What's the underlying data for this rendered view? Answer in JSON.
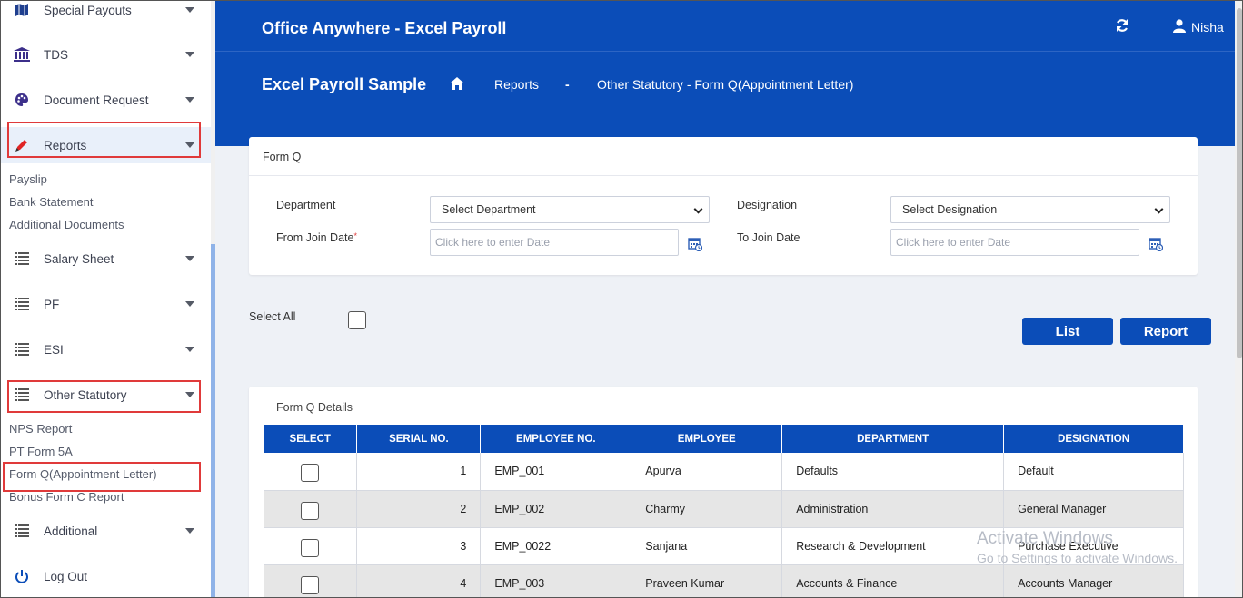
{
  "header": {
    "app_title": "Office Anywhere - Excel Payroll",
    "user_name": "Nisha"
  },
  "banner": {
    "page_title": "Excel Payroll Sample",
    "crumb_reports": "Reports",
    "crumb_sep": "-",
    "crumb_current": "Other Statutory - Form Q(Appointment Letter)"
  },
  "sidebar": {
    "items": [
      {
        "label": "Special Payouts",
        "icon": "map-icon"
      },
      {
        "label": "TDS",
        "icon": "bank-icon"
      },
      {
        "label": "Document Request",
        "icon": "palette-icon"
      },
      {
        "label": "Reports",
        "icon": "pencil-icon"
      },
      {
        "label": "Salary Sheet",
        "icon": "list-icon"
      },
      {
        "label": "PF",
        "icon": "list-icon"
      },
      {
        "label": "ESI",
        "icon": "list-icon"
      },
      {
        "label": "Other Statutory",
        "icon": "list-icon"
      },
      {
        "label": "Additional",
        "icon": "list-icon"
      },
      {
        "label": "Log Out",
        "icon": "power-icon"
      }
    ],
    "reports_sub": [
      "Payslip",
      "Bank Statement",
      "Additional Documents"
    ],
    "statutory_sub": [
      "NPS Report",
      "PT Form 5A",
      "Form Q(Appointment Letter)",
      "Bonus Form C Report"
    ]
  },
  "form": {
    "title": "Form Q",
    "department_label": "Department",
    "department_value": "Select Department",
    "designation_label": "Designation",
    "designation_value": "Select Designation",
    "from_date_label": "From Join Date",
    "required_mark": "*",
    "from_date_placeholder": "Click here to enter Date",
    "to_date_label": "To Join Date",
    "to_date_placeholder": "Click here to enter Date"
  },
  "actions": {
    "select_all_label": "Select All",
    "list_button": "List",
    "report_button": "Report"
  },
  "details": {
    "title": "Form Q Details",
    "columns": [
      "SELECT",
      "SERIAL NO.",
      "EMPLOYEE NO.",
      "EMPLOYEE",
      "DEPARTMENT",
      "DESIGNATION"
    ],
    "rows": [
      {
        "serial": "1",
        "emp_no": "EMP_001",
        "employee": "Apurva",
        "department": "Defaults",
        "designation": "Default"
      },
      {
        "serial": "2",
        "emp_no": "EMP_002",
        "employee": "Charmy",
        "department": "Administration",
        "designation": "General Manager"
      },
      {
        "serial": "3",
        "emp_no": "EMP_0022",
        "employee": "Sanjana",
        "department": "Research & Development",
        "designation": "Purchase Executive"
      },
      {
        "serial": "4",
        "emp_no": "EMP_003",
        "employee": "Praveen Kumar",
        "department": "Accounts & Finance",
        "designation": "Accounts Manager"
      }
    ]
  },
  "watermark": {
    "line1": "Activate Windows",
    "line2": "Go to Settings to activate Windows."
  },
  "colors": {
    "brand": "#0b4db8",
    "highlight": "#e03a3a"
  }
}
